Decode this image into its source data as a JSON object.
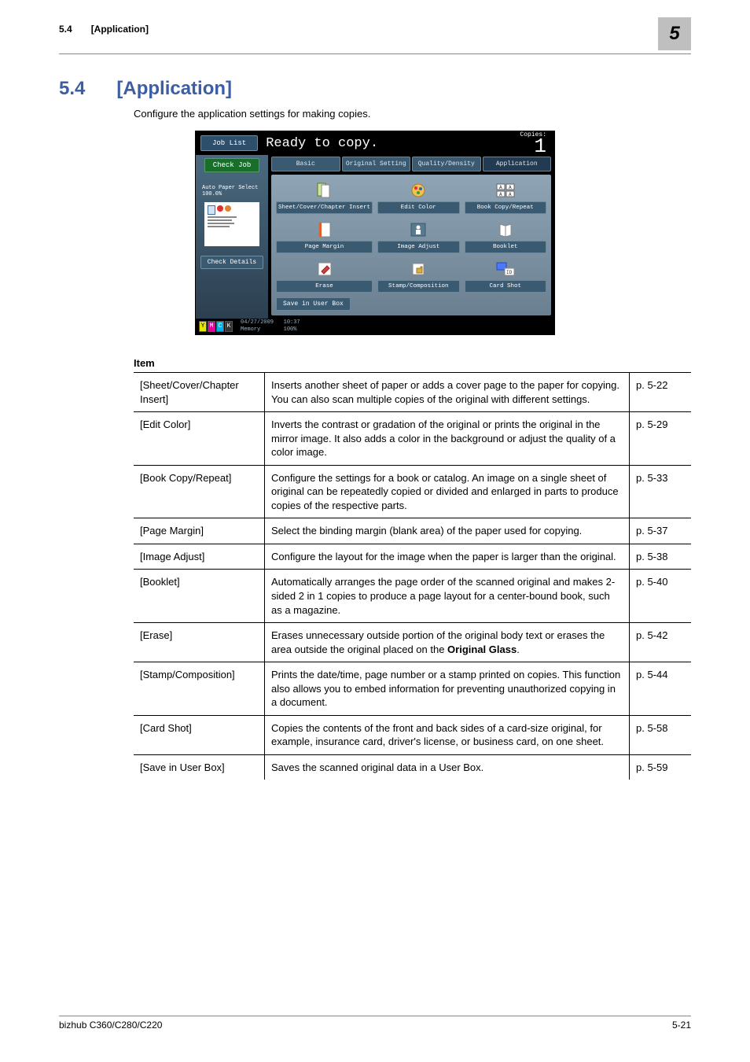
{
  "running_head": {
    "section_num": "5.4",
    "section_title": "[Application]",
    "chapter_num": "5"
  },
  "heading": {
    "num": "5.4",
    "title": "[Application]"
  },
  "intro": "Configure the application settings for making copies.",
  "screenshot": {
    "job_list": "Job List",
    "ready": "Ready to copy.",
    "copies_label": "Copies:",
    "copies_value": "1",
    "check_job": "Check Job",
    "auto_paper": "Auto Paper Select  100.0%",
    "check_details": "Check Details",
    "tabs": {
      "basic": "Basic",
      "original": "Original Setting",
      "quality": "Quality/Density",
      "application": "Application"
    },
    "items": {
      "sheet": "Sheet/Cover/Chapter Insert",
      "editcolor": "Edit Color",
      "bookcopy": "Book Copy/Repeat",
      "pagemargin": "Page Margin",
      "imageadjust": "Image Adjust",
      "booklet": "Booklet",
      "erase": "Erase",
      "stamp": "Stamp/Composition",
      "cardshot": "Card Shot"
    },
    "save": "Save in User Box",
    "date": "04/27/2009",
    "time": "10:37",
    "memory": "Memory",
    "memval": "100%"
  },
  "table_header": "Item",
  "rows": [
    {
      "item": "[Sheet/Cover/Chapter Insert]",
      "desc": "Inserts another sheet of paper or adds a cover page to the paper for copying. You can also scan multiple copies of the original with different settings.",
      "page": "p. 5-22"
    },
    {
      "item": "[Edit Color]",
      "desc": "Inverts the contrast or gradation of the original or prints the original in the mirror image. It also adds a color in the background or adjust the quality of a color image.",
      "page": "p. 5-29"
    },
    {
      "item": "[Book Copy/Repeat]",
      "desc": "Configure the settings for a book or catalog. An image on a single sheet of original can be repeatedly copied or divided and enlarged in parts to produce copies of the respective parts.",
      "page": "p. 5-33"
    },
    {
      "item": "[Page Margin]",
      "desc": "Select the binding margin (blank area) of the paper used for copying.",
      "page": "p. 5-37"
    },
    {
      "item": "[Image Adjust]",
      "desc": "Configure the layout for the image when the paper is larger than the original.",
      "page": "p. 5-38"
    },
    {
      "item": "[Booklet]",
      "desc": "Automatically arranges the page order of the scanned original and makes 2-sided 2 in 1 copies to produce a page layout for a center-bound book, such as a magazine.",
      "page": "p. 5-40"
    },
    {
      "item": "[Erase]",
      "desc_html": "Erases unnecessary outside portion of the original body text or erases the area outside the original placed on the <b>Original Glass</b>.",
      "page": "p. 5-42"
    },
    {
      "item": "[Stamp/Composition]",
      "desc": "Prints the date/time, page number or a stamp printed on copies. This function also allows you to embed information for preventing unauthorized copying in a document.",
      "page": "p. 5-44"
    },
    {
      "item": "[Card Shot]",
      "desc": "Copies the contents of the front and back sides of a card-size original, for example, insurance card, driver's license, or business card, on one sheet.",
      "page": "p. 5-58"
    },
    {
      "item": "[Save in User Box]",
      "desc": "Saves the scanned original data in a User Box.",
      "page": "p. 5-59"
    }
  ],
  "footer": {
    "left": "bizhub C360/C280/C220",
    "right": "5-21"
  }
}
